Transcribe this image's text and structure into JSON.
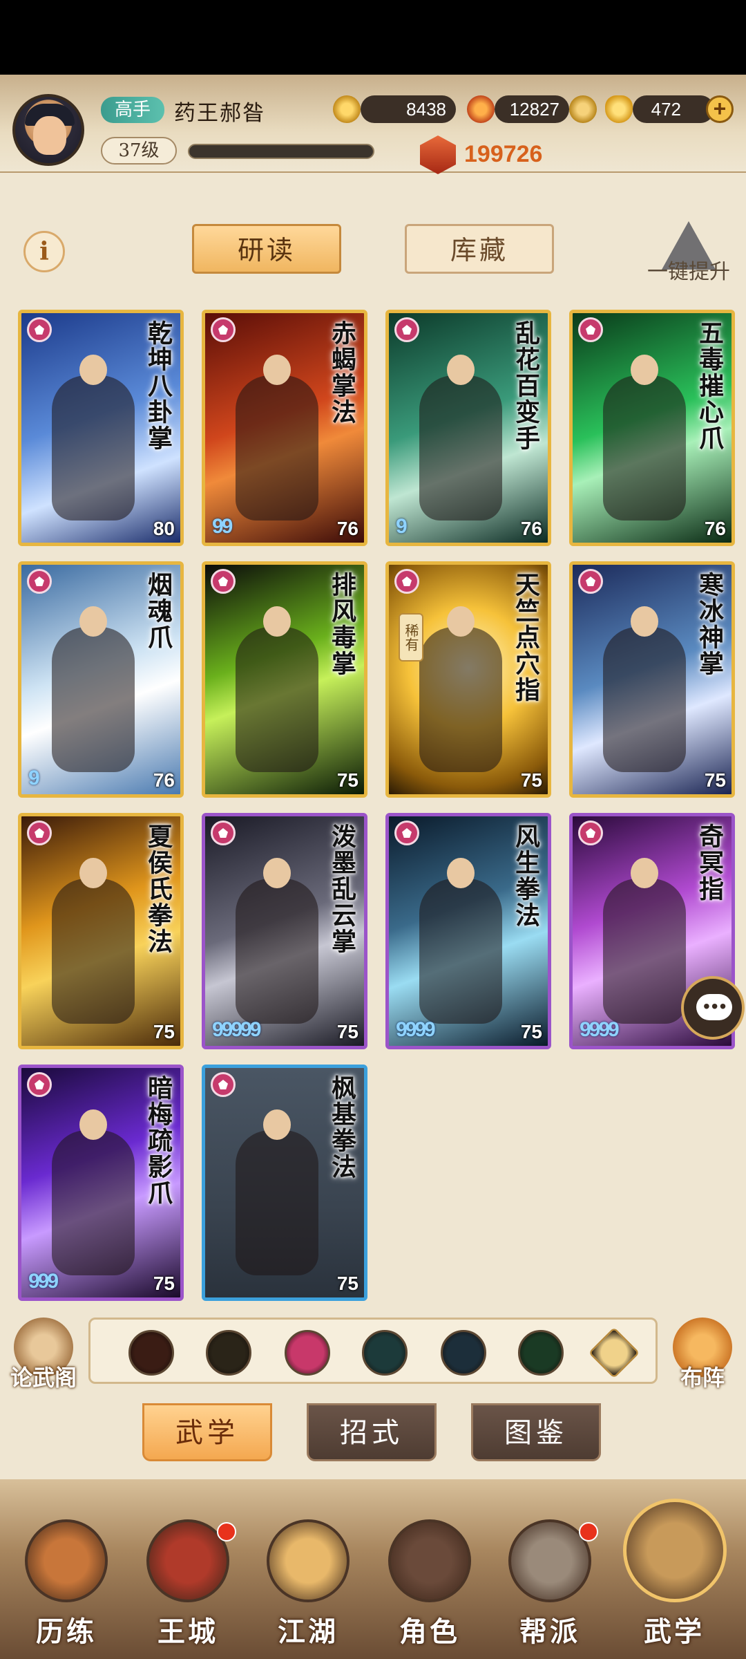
{
  "header": {
    "rank_label": "高手",
    "player_name": "药王郝昝",
    "coins": "8438",
    "spirit": "12827",
    "ingots": "472",
    "level": "37级",
    "exp_fraction": 0.0,
    "power": "199726"
  },
  "top_tabs": {
    "study": "研读",
    "storage": "库藏"
  },
  "upgrade_label": "一键提升",
  "cards": [
    {
      "name": "乾坤八卦掌",
      "score": "80",
      "beads": "",
      "frame": "gold",
      "rare": ""
    },
    {
      "name": "赤蝎掌法",
      "score": "76",
      "beads": "99",
      "frame": "gold",
      "rare": ""
    },
    {
      "name": "乱花百变手",
      "score": "76",
      "beads": "9",
      "frame": "gold",
      "rare": ""
    },
    {
      "name": "五毒摧心爪",
      "score": "76",
      "beads": "",
      "frame": "gold",
      "rare": ""
    },
    {
      "name": "烟魂爪",
      "score": "76",
      "beads": "9",
      "frame": "gold",
      "rare": ""
    },
    {
      "name": "排风毒掌",
      "score": "75",
      "beads": "",
      "frame": "gold",
      "rare": ""
    },
    {
      "name": "天竺点穴指",
      "score": "75",
      "beads": "",
      "frame": "gold",
      "rare": "稀有"
    },
    {
      "name": "寒冰神掌",
      "score": "75",
      "beads": "",
      "frame": "gold",
      "rare": ""
    },
    {
      "name": "夏侯氏拳法",
      "score": "75",
      "beads": "",
      "frame": "gold",
      "rare": ""
    },
    {
      "name": "泼墨乱云掌",
      "score": "75",
      "beads": "99999",
      "frame": "purple",
      "rare": ""
    },
    {
      "name": "风生拳法",
      "score": "75",
      "beads": "9999",
      "frame": "purple",
      "rare": ""
    },
    {
      "name": "奇冥指",
      "score": "75",
      "beads": "9999",
      "frame": "purple",
      "rare": ""
    },
    {
      "name": "暗梅疏影爪",
      "score": "75",
      "beads": "999",
      "frame": "purple",
      "rare": ""
    },
    {
      "name": "枫基拳法",
      "score": "75",
      "beads": "",
      "frame": "blue",
      "rare": ""
    }
  ],
  "left_side_label": "论武阁",
  "right_side_label": "布阵",
  "filter_icons": [
    "sword-icon",
    "blade-icon",
    "palm-icon",
    "fan-icon",
    "taiji-icon",
    "claw-icon",
    "collapse-icon"
  ],
  "sub_tabs": {
    "martial": "武学",
    "moves": "招式",
    "atlas": "图鉴"
  },
  "bottom_nav": [
    "历练",
    "王城",
    "江湖",
    "角色",
    "帮派",
    "武学"
  ],
  "colors": {
    "gold_frame": "#e7b640",
    "purple_frame": "#9b54c9",
    "blue_frame": "#3ba0dc",
    "accent_orange": "#d7611c"
  }
}
